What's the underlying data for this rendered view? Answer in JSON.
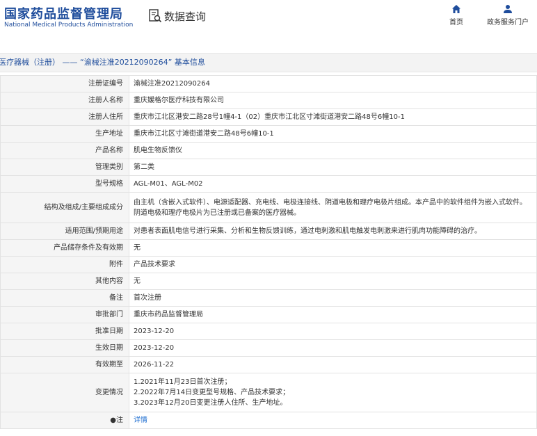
{
  "header": {
    "logo_cn": "国家药品监督管理局",
    "logo_en": "National Medical Products Administration",
    "search_title": "数据查询",
    "nav_home": "首页",
    "nav_gov": "政务服务门户"
  },
  "breadcrumb": "医疗器械（注册） —— “渝械注准20212090264” 基本信息",
  "rows": [
    {
      "label": "注册证编号",
      "value": "渝械注准20212090264"
    },
    {
      "label": "注册人名称",
      "value": "重庆嫒格尔医疗科技有限公司"
    },
    {
      "label": "注册人住所",
      "value": "重庆市江北区港安二路28号1幢4-1（02）重庆市江北区寸滩街道港安二路48号6幢10-1"
    },
    {
      "label": "生产地址",
      "value": "重庆市江北区寸滩街道港安二路48号6幢10-1"
    },
    {
      "label": "产品名称",
      "value": "肌电生物反馈仪"
    },
    {
      "label": "管理类别",
      "value": "第二类"
    },
    {
      "label": "型号规格",
      "value": "AGL-M01、AGL-M02"
    },
    {
      "label": "结构及组成/主要组成成分",
      "value": "由主机（含嵌入式软件）、电源适配器、充电线、电极连接线、阴道电极和理疗电极片组成。本产品中的软件组件为嵌入式软件。阴道电极和理疗电极片为已注册或已备案的医疗器械。"
    },
    {
      "label": "适用范围/预期用途",
      "value": "对患者表面肌电信号进行采集、分析和生物反馈训练，通过电刺激和肌电触发电刺激来进行肌肉功能障碍的治疗。"
    },
    {
      "label": "产品储存条件及有效期",
      "value": "无"
    },
    {
      "label": "附件",
      "value": "产品技术要求"
    },
    {
      "label": "其他内容",
      "value": "无"
    },
    {
      "label": "备注",
      "value": "首次注册"
    },
    {
      "label": "审批部门",
      "value": "重庆市药品监督管理局"
    },
    {
      "label": "批准日期",
      "value": "2023-12-20"
    },
    {
      "label": "生效日期",
      "value": "2023-12-20"
    },
    {
      "label": "有效期至",
      "value": "2026-11-22"
    }
  ],
  "change_history": {
    "label": "变更情况",
    "lines": [
      "1.2021年11月23日首次注册；",
      "2.2022年7月14日变更型号规格、产品技术要求；",
      "3.2023年12月20日变更注册人住所、生产地址。"
    ]
  },
  "note_row": {
    "label": "注",
    "link": "详情"
  },
  "colors": {
    "brand": "#1f4d9c",
    "link": "#1f6fd0",
    "label_bg": "#f5f5f5",
    "border": "#e2e2e2"
  }
}
